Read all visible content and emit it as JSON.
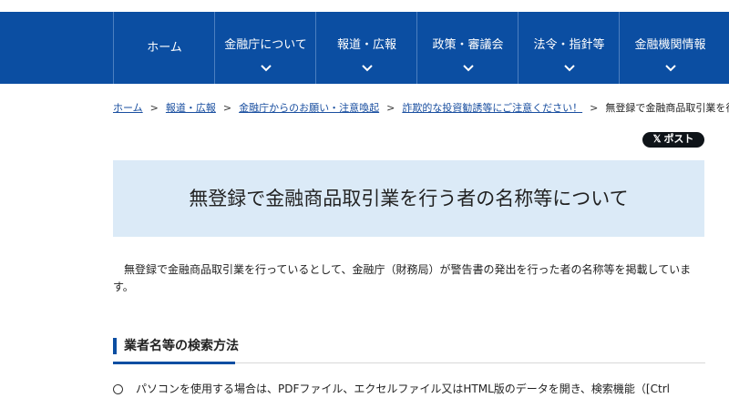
{
  "nav": {
    "items": [
      {
        "label": "ホーム"
      },
      {
        "label": "金融庁について"
      },
      {
        "label": "報道・広報"
      },
      {
        "label": "政策・審議会"
      },
      {
        "label": "法令・指針等"
      },
      {
        "label": "金融機関情報"
      }
    ]
  },
  "breadcrumb": {
    "home": "ホーム",
    "item1": "報道・広報",
    "item2": "金融庁からのお願い・注意喚起",
    "item3": "詐欺的な投資勧誘等にご注意ください！",
    "current": "無登録で金融商品取引業を行う者の",
    "separator": ">"
  },
  "share": {
    "x_post_label": "ポスト",
    "x_glyph": "𝕏"
  },
  "page": {
    "title": "無登録で金融商品取引業を行う者の名称等について",
    "intro": "無登録で金融商品取引業を行っているとして、金融庁（財務局）が警告書の発出を行った者の名称等を掲載しています。"
  },
  "section": {
    "heading": "業者名等の検索方法",
    "bullet1": "パソコンを使用する場合は、PDFファイル、エクセルファイル又はHTML版のデータを開き、検索機能（[Ctrl"
  },
  "colors": {
    "brand_blue": "#0b4ea2",
    "title_bg": "#dbeaf7",
    "link": "#1a4fa0"
  }
}
